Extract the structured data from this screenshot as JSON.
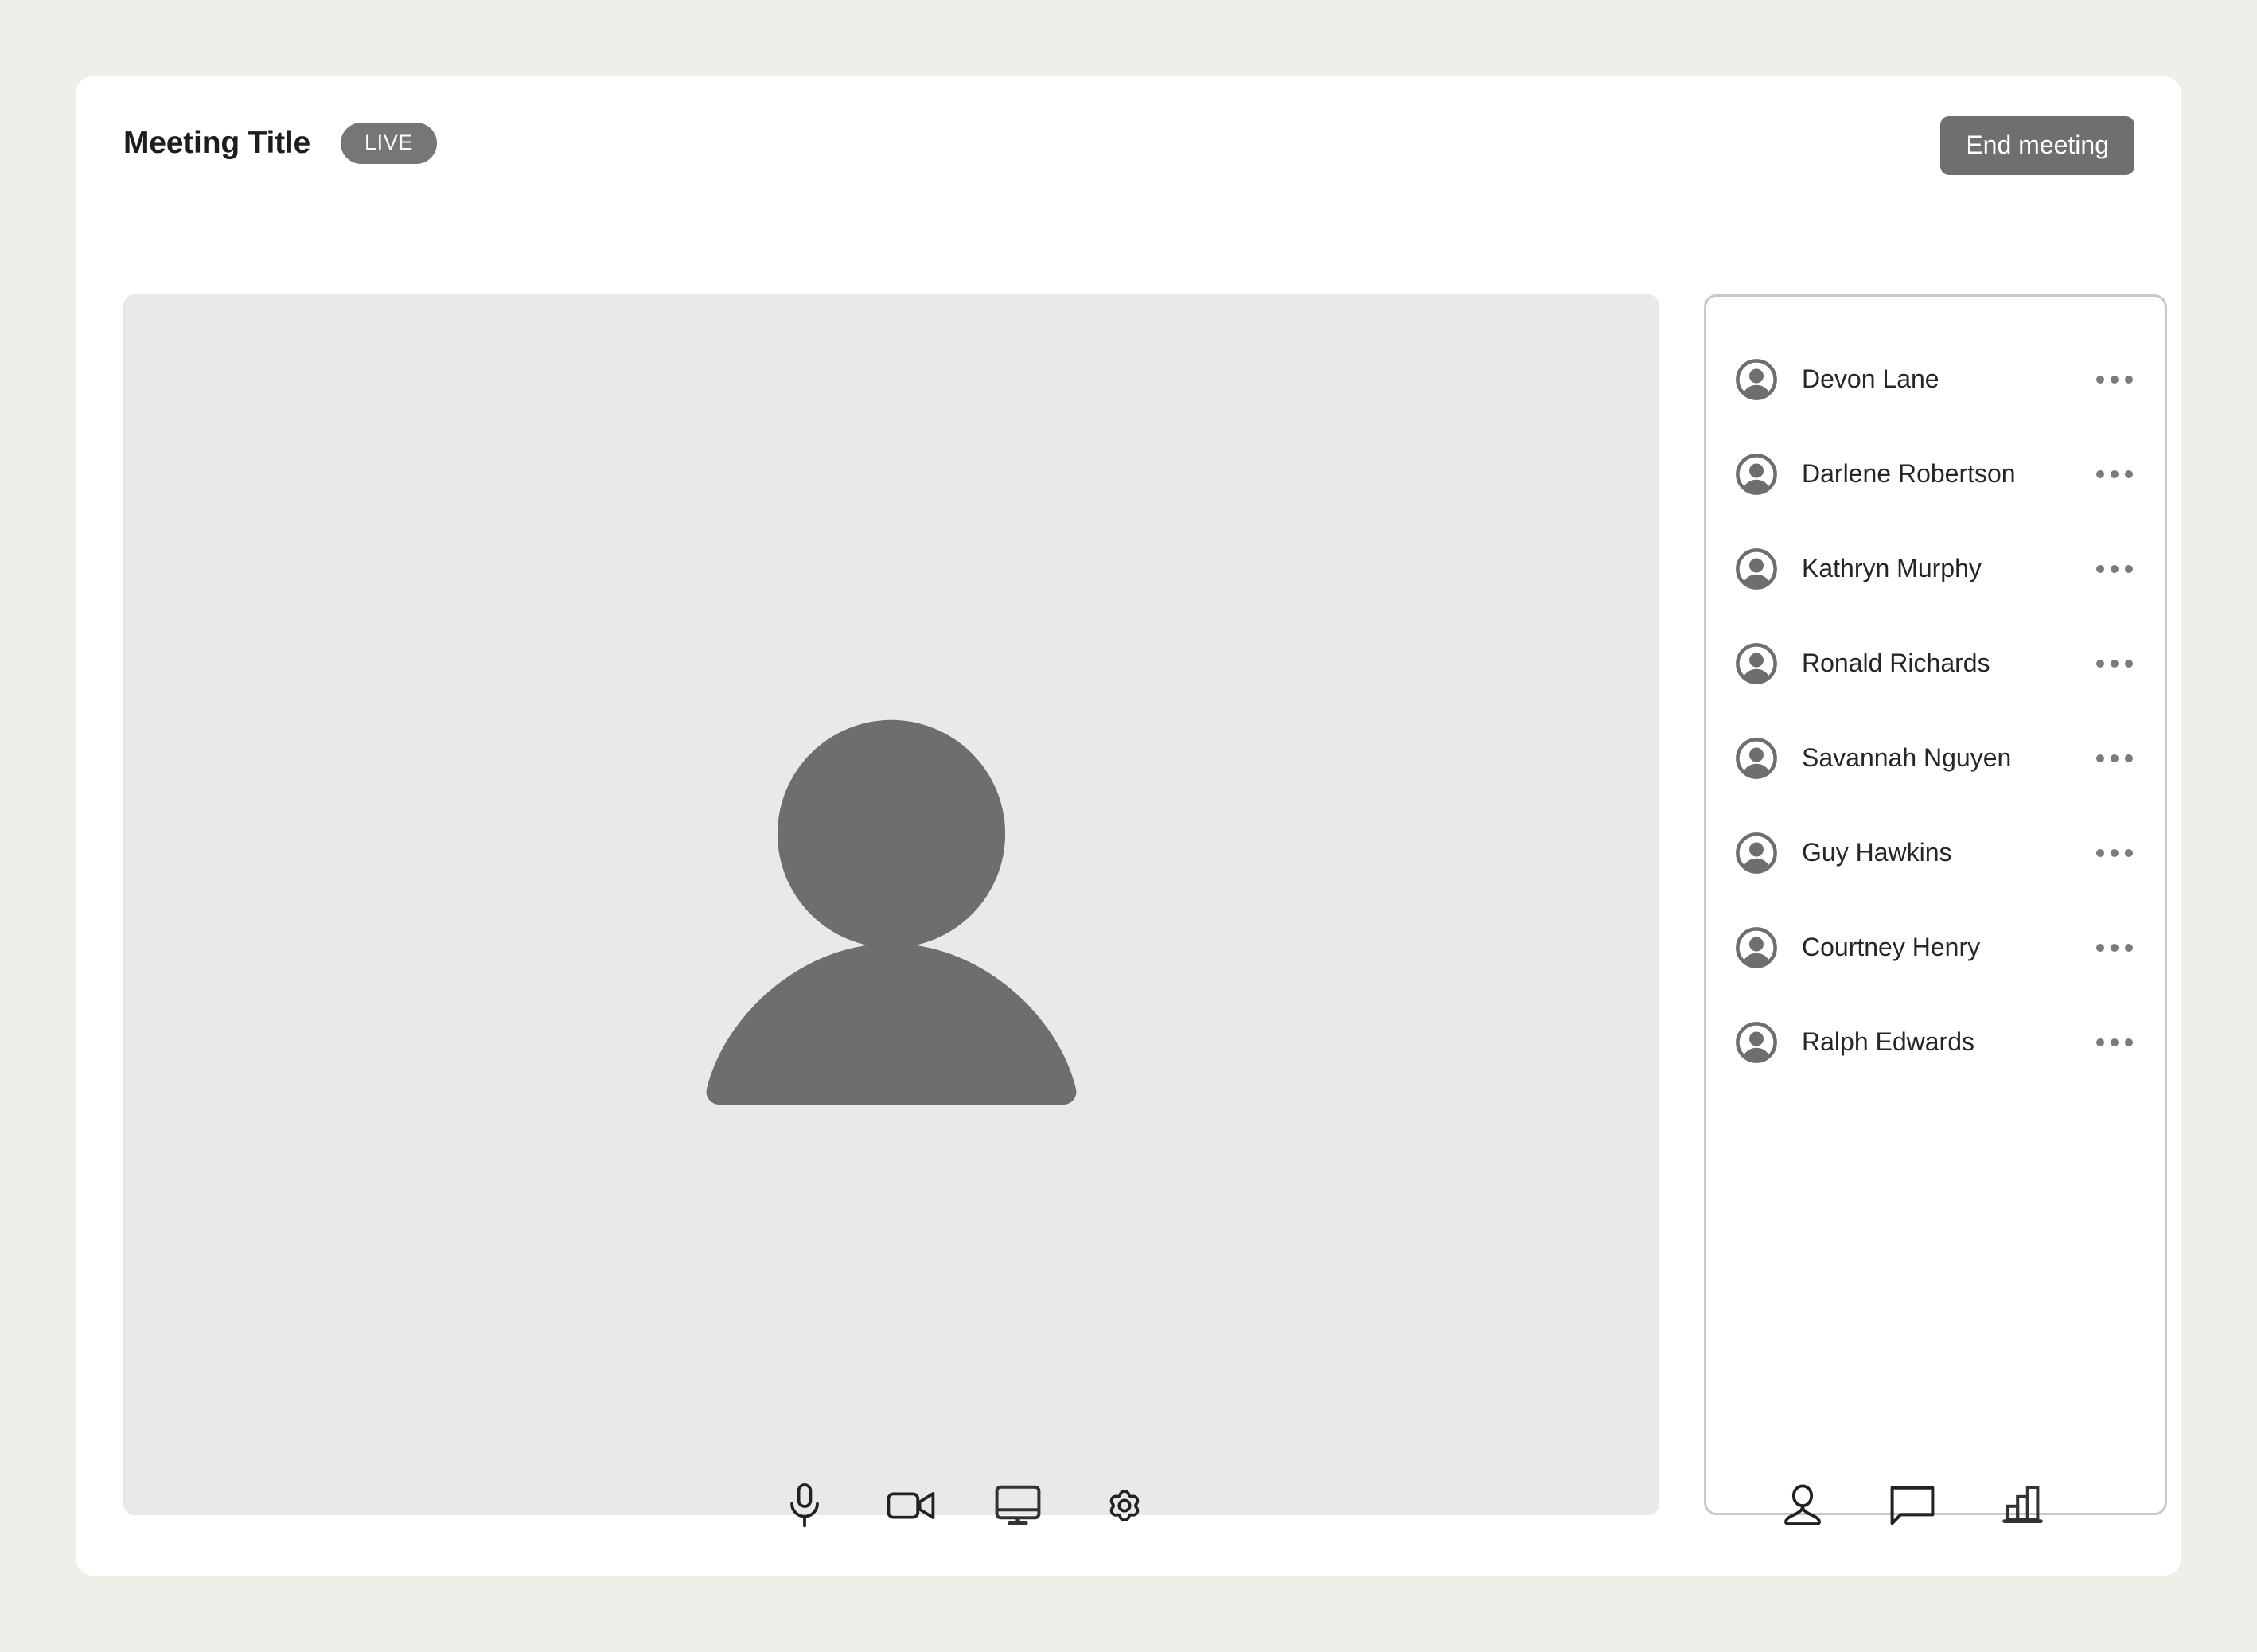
{
  "page": {
    "background_color": "#efefe9",
    "card_background": "#ffffff"
  },
  "header": {
    "title": "Meeting Title",
    "live_badge": "LIVE",
    "live_badge_color": "#767676",
    "end_meeting_label": "End meeting",
    "end_meeting_color": "#6f6f6f"
  },
  "stage": {
    "background_color": "#e9e9e9",
    "placeholder_icon": "person-silhouette-icon",
    "placeholder_color": "#6e6e6e"
  },
  "participants": {
    "panel_border_color": "#c9c9c9",
    "menu_icon": "more-options-icon",
    "avatar_icon": "user-circle-icon",
    "items": [
      {
        "name": "Devon Lane"
      },
      {
        "name": "Darlene Robertson"
      },
      {
        "name": "Kathryn Murphy"
      },
      {
        "name": "Ronald Richards"
      },
      {
        "name": "Savannah Nguyen"
      },
      {
        "name": "Guy Hawkins"
      },
      {
        "name": "Courtney Henry"
      },
      {
        "name": "Ralph Edwards"
      }
    ]
  },
  "toolbar": {
    "left_controls": [
      {
        "icon": "microphone-icon",
        "label": "Microphone"
      },
      {
        "icon": "video-camera-icon",
        "label": "Camera"
      },
      {
        "icon": "screen-share-icon",
        "label": "Share screen"
      },
      {
        "icon": "gear-icon",
        "label": "Settings"
      }
    ],
    "right_controls": [
      {
        "icon": "participants-icon",
        "label": "Participants"
      },
      {
        "icon": "chat-icon",
        "label": "Chat"
      },
      {
        "icon": "stats-icon",
        "label": "Statistics"
      }
    ],
    "icon_color": "#333333"
  }
}
